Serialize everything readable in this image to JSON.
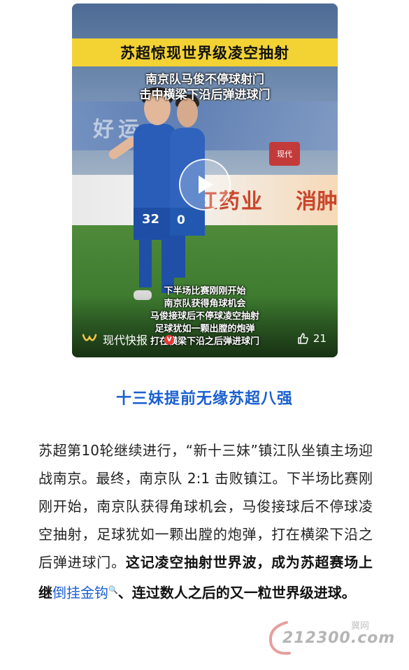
{
  "video": {
    "title_banner": "苏超惊现世界级凌空抽射",
    "subtitle_line1": "南京队马俊不停球射门",
    "subtitle_line2": "击中横梁下沿后弹进球门",
    "captions": [
      "下半场比赛刚刚开始",
      "南京队获得角球机会",
      "马俊接球后不停球凌空抽射",
      "足球犹如一颗出膛的炮弹",
      "打在横梁下沿之后弹进球门"
    ],
    "bg_text_left": "好运",
    "ad_text": "红药业",
    "ad_text_right": "消肿",
    "logo_badge": "现代",
    "jersey_1": "32",
    "jersey_2": "0",
    "channel_name": "现代快报",
    "verified_badge": "V",
    "like_count": "21"
  },
  "article": {
    "section_title": "十三妹提前无缘苏超八强",
    "paragraph_plain": "苏超第10轮继续进行，“新十三妹”镇江队坐镇主场迎战南京。最终，南京队 2:1 击败镇江。下半场比赛刚刚开始，南京队获得角球机会，马俊接球后不停球凌空抽射，足球犹如一颗出膛的炮弹，打在横梁下沿之后弹进球门。",
    "paragraph_bold_1": "这记凌空抽射世界波，成为苏超赛场上继",
    "paragraph_link": "倒挂金钩",
    "paragraph_bold_2": "、连过数人之后的又一粒世界级进球。"
  },
  "watermark": {
    "site": "212300.com",
    "label": "冀网"
  },
  "colors": {
    "accent_blue": "#1a5fd0",
    "banner_yellow": "#f3d234",
    "verified_red": "#e53935"
  }
}
